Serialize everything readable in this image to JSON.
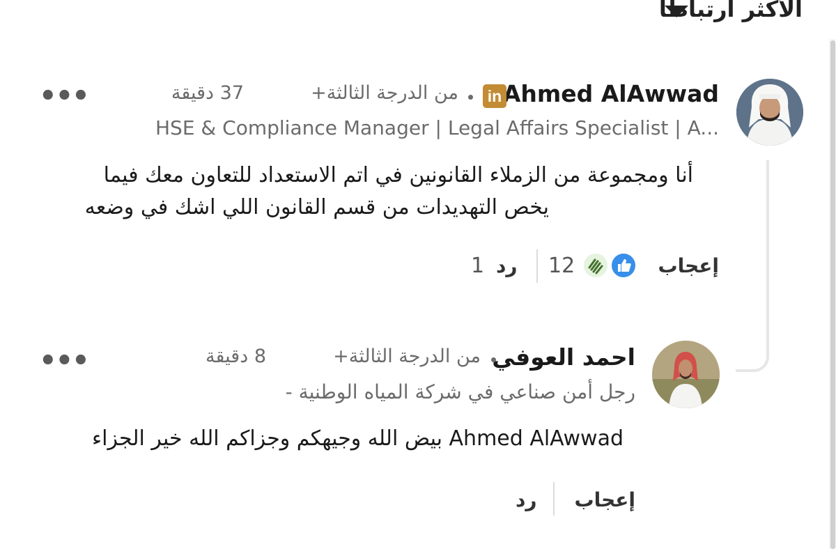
{
  "sort": {
    "label": "الأكثر ارتباطا"
  },
  "comments": [
    {
      "author": "Ahmed AlAwwad",
      "badge": "in",
      "degree": "من الدرجة الثالثة+",
      "time": "37 دقيقة",
      "headline": "HSE & Compliance Manager | Legal Affairs Specialist | A...",
      "text_line1": "أنا ومجموعة من الزملاء القانونين في اتم الاستعداد للتعاون معك فيما",
      "text_line2": "يخص التهديدات من قسم القانون اللي اشك في وضعه",
      "like_label": "إعجاب",
      "reaction_count": "12",
      "reply_label": "رد",
      "reply_count": "1",
      "more": "•••"
    },
    {
      "author": "احمد العوفي",
      "degree": "من الدرجة الثالثة+",
      "time": "8 دقيقة",
      "headline": "رجل أمن صناعي في شركة المياه الوطنية -",
      "mention": "Ahmed AlAwwad",
      "text": "بيض الله وجيهكم وجزاكم الله خير الجزاء",
      "like_label": "إعجاب",
      "reply_label": "رد",
      "more": "•••"
    }
  ],
  "icons": {
    "sort_caret": "caret-down-icon",
    "more": "more-icon",
    "badge": "linkedin-icon",
    "reactions": [
      "like-icon",
      "clap-icon"
    ]
  },
  "colors": {
    "linkedin_badge": "#c28b34",
    "like_blue": "#378fe9",
    "celebrate_green": "#44712e"
  }
}
